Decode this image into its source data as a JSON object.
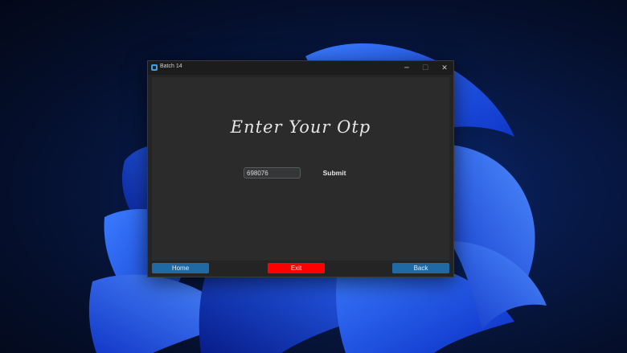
{
  "window": {
    "title": "Batch 14",
    "minimize_glyph": "─",
    "maximize_glyph": "☐",
    "close_glyph": "✕"
  },
  "main": {
    "heading": "Enter Your Otp",
    "otp_value": "698076",
    "submit_label": "Submit"
  },
  "footer": {
    "home_label": "Home",
    "exit_label": "Exit",
    "back_label": "Back"
  },
  "icons": {
    "app": "app-logo-icon",
    "minimize": "minimize-icon",
    "maximize": "maximize-icon",
    "close": "close-icon"
  },
  "colors": {
    "primary_button": "#1f6aa5",
    "exit_button": "#ff0000",
    "window_bg": "#242424",
    "content_bg": "#2b2b2b"
  }
}
